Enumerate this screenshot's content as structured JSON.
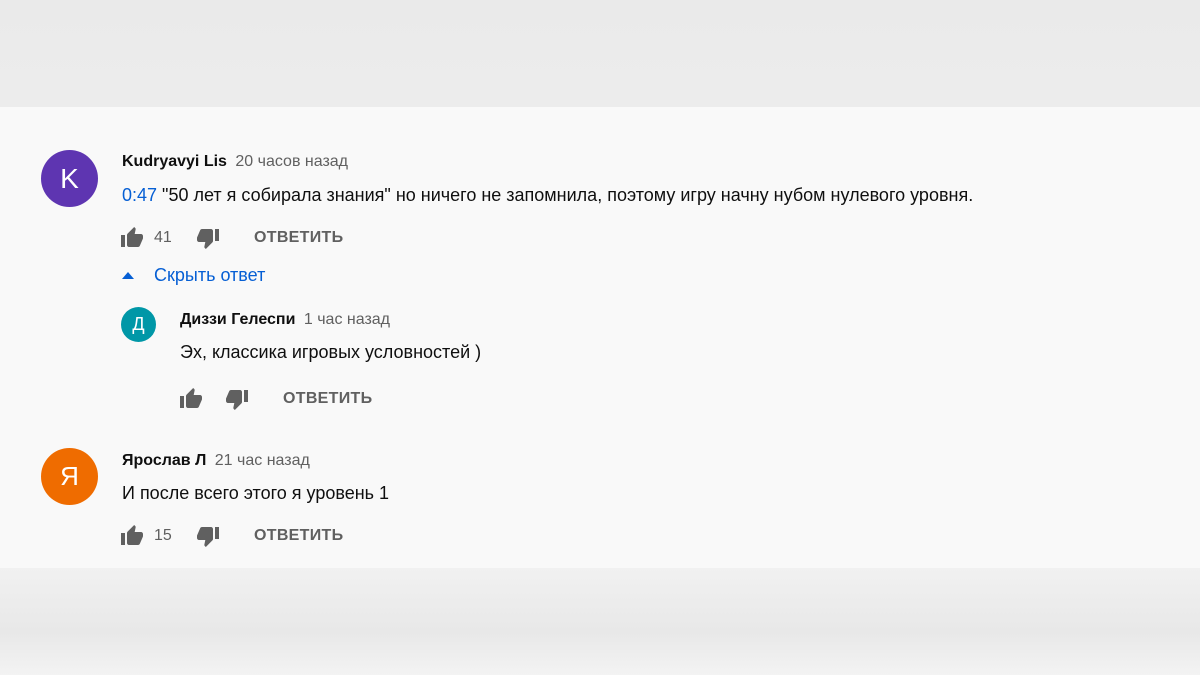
{
  "comments": [
    {
      "avatar_letter": "K",
      "avatar_color": "#5e35b1",
      "author": "Kudryavyi Lis",
      "time": "20 часов назад",
      "timestamp_link": "0:47",
      "text": " \"50 лет я собирала знания\" но ничего не запомнила, поэтому игру начну нубом нулевого уровня.",
      "likes": "41",
      "reply_label": "ОТВЕТИТЬ",
      "toggle_label": "Скрыть ответ",
      "replies": [
        {
          "avatar_letter": "Д",
          "avatar_color": "#0097a7",
          "author": "Диззи Гелеспи",
          "time": "1 час назад",
          "text": "Эх, классика игровых условностей )",
          "likes": "",
          "reply_label": "ОТВЕТИТЬ"
        }
      ]
    },
    {
      "avatar_letter": "Я",
      "avatar_color": "#ef6c00",
      "author": "Ярослав Л",
      "time": "21 час назад",
      "text": "И после всего этого я уровень 1",
      "likes": "15",
      "reply_label": "ОТВЕТИТЬ"
    }
  ]
}
